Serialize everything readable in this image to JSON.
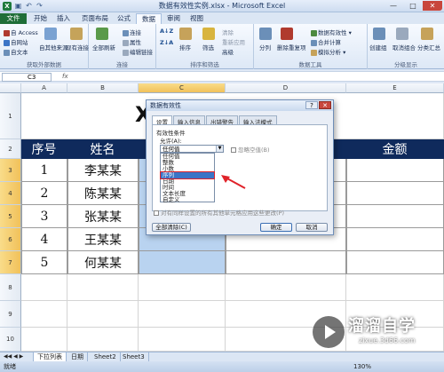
{
  "window": {
    "title": "数据有效性实例.xlsx - Microsoft Excel",
    "app_icon": "X",
    "controls": [
      "—",
      "□",
      "✕"
    ]
  },
  "ribbon_tabs": [
    "文件",
    "开始",
    "插入",
    "页面布局",
    "公式",
    "数据",
    "审阅",
    "视图"
  ],
  "ribbon": {
    "external_data": {
      "items": [
        "自 Access",
        "自网站",
        "自文本"
      ],
      "other_sources": "自其他来源",
      "existing": "现有连接",
      "label": "获取外部数据"
    },
    "connections": {
      "refresh_all": "全部刷新",
      "items": [
        "连接",
        "属性",
        "编辑链接"
      ],
      "label": "连接"
    },
    "sort_filter": {
      "sort": "排序",
      "filter": "筛选",
      "items": [
        "清除",
        "重新应用",
        "高级"
      ],
      "label": "排序和筛选"
    },
    "data_tools": {
      "split": "分列",
      "dedupe": "删除重复项",
      "items": [
        "数据有效性 ▾",
        "合并计算",
        "模拟分析 ▾"
      ],
      "label": "数据工具"
    },
    "outline": {
      "items": [
        "创建组",
        "取消组合",
        "分类汇总"
      ],
      "label": "分级显示"
    }
  },
  "formula_bar": {
    "name_box": "C3",
    "fx": "fx"
  },
  "columns": [
    "A",
    "B",
    "C",
    "D",
    "E"
  ],
  "rows": [
    "1",
    "2",
    "3",
    "4",
    "5",
    "6",
    "7",
    "8",
    "9",
    "10"
  ],
  "sheet": {
    "title_partial": "X",
    "headers": [
      "序号",
      "姓名",
      "",
      "",
      "金额"
    ],
    "data": [
      [
        "1",
        "李某某"
      ],
      [
        "2",
        "陈某某"
      ],
      [
        "3",
        "张某某"
      ],
      [
        "4",
        "王某某"
      ],
      [
        "5",
        "何某某"
      ]
    ]
  },
  "sheet_tabs": [
    "下拉列表",
    "日期",
    "Sheet2",
    "Sheet3"
  ],
  "status": {
    "ready": "就绪",
    "zoom": "130%"
  },
  "dialog": {
    "title": "数据有效性",
    "tabs": [
      "设置",
      "输入信息",
      "出错警告",
      "输入法模式"
    ],
    "section": "有效性条件",
    "allow_label": "允许(A):",
    "allow_value": "任何值",
    "ignore_blank": "忽略空值(B)",
    "options": [
      "任何值",
      "整数",
      "小数",
      "序列",
      "日期",
      "时间",
      "文本长度",
      "自定义"
    ],
    "highlighted_option": "序列",
    "apply_all": "对有同样设置的所有其他单元格应用这些更改(P)",
    "clear_all": "全部清除(C)",
    "ok": "确定",
    "cancel": "取消"
  },
  "watermark": {
    "brand": "溜溜自学",
    "url": "zixue.3d66.com"
  },
  "colors": {
    "header_fill": "#0f2a5c",
    "file_tab": "#1f6e38",
    "selection": "#b9d3f0",
    "highlight": "#3b74c6",
    "annotation": "#e0232a"
  }
}
